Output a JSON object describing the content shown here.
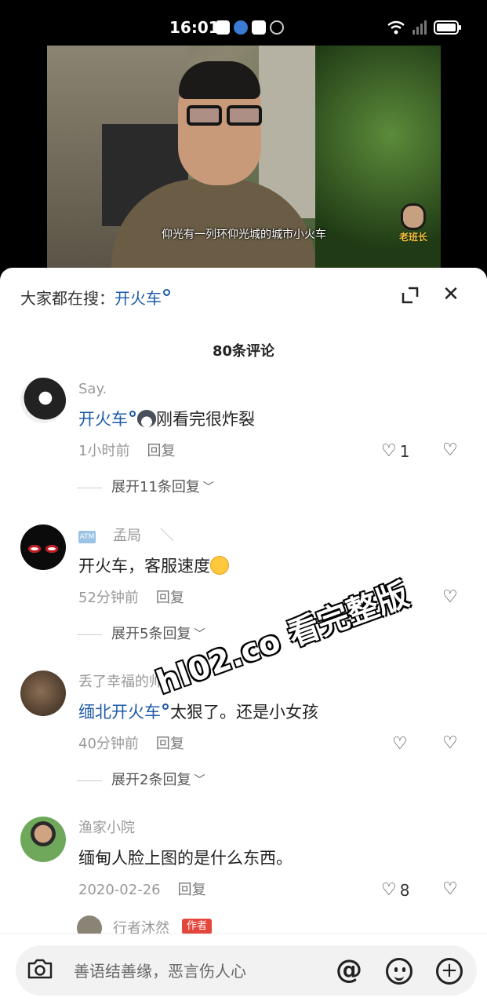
{
  "status_bar": {
    "time": "16:01"
  },
  "video": {
    "subtitle": "仰光有一列环仰光城的城市小火车",
    "logo_text": "老班长"
  },
  "panel": {
    "search_prefix": "大家都在搜：",
    "search_term": "开火车",
    "comment_count": "80条评论"
  },
  "comments": [
    {
      "name": "Say.",
      "link_text": "开火车",
      "text": "刚看完很炸裂",
      "time": "1小时前",
      "reply": "回复",
      "likes": "1",
      "expand": "展开11条回复"
    },
    {
      "badge": "ATM",
      "name": "孟局",
      "extra": "＼",
      "text": "开火车，客服速度",
      "time": "52分钟前",
      "reply": "回复",
      "likes": "",
      "expand": "展开5条回复"
    },
    {
      "name": "丢了幸福的帅",
      "link_text": "缅北开火车",
      "text": "太狠了。还是小女孩",
      "time": "40分钟前",
      "reply": "回复",
      "likes": "",
      "expand": "展开2条回复"
    },
    {
      "name": "渔家小院",
      "text": "缅甸人脸上图的是什么东西。",
      "time": "2020-02-26",
      "reply": "回复",
      "likes": "8"
    }
  ],
  "next_preview": {
    "name": "行者沐然",
    "tag": "作者"
  },
  "watermark": "hl02.co 看完整版",
  "input": {
    "placeholder": "善语结善缘，恶言伤人心"
  },
  "icons": {
    "like": "heart-outline",
    "dislike": "broken-heart",
    "expand": "chevron-down",
    "close": "close-x",
    "camera": "camera",
    "at": "at-sign",
    "emoji": "smiley",
    "add": "plus-circle"
  }
}
